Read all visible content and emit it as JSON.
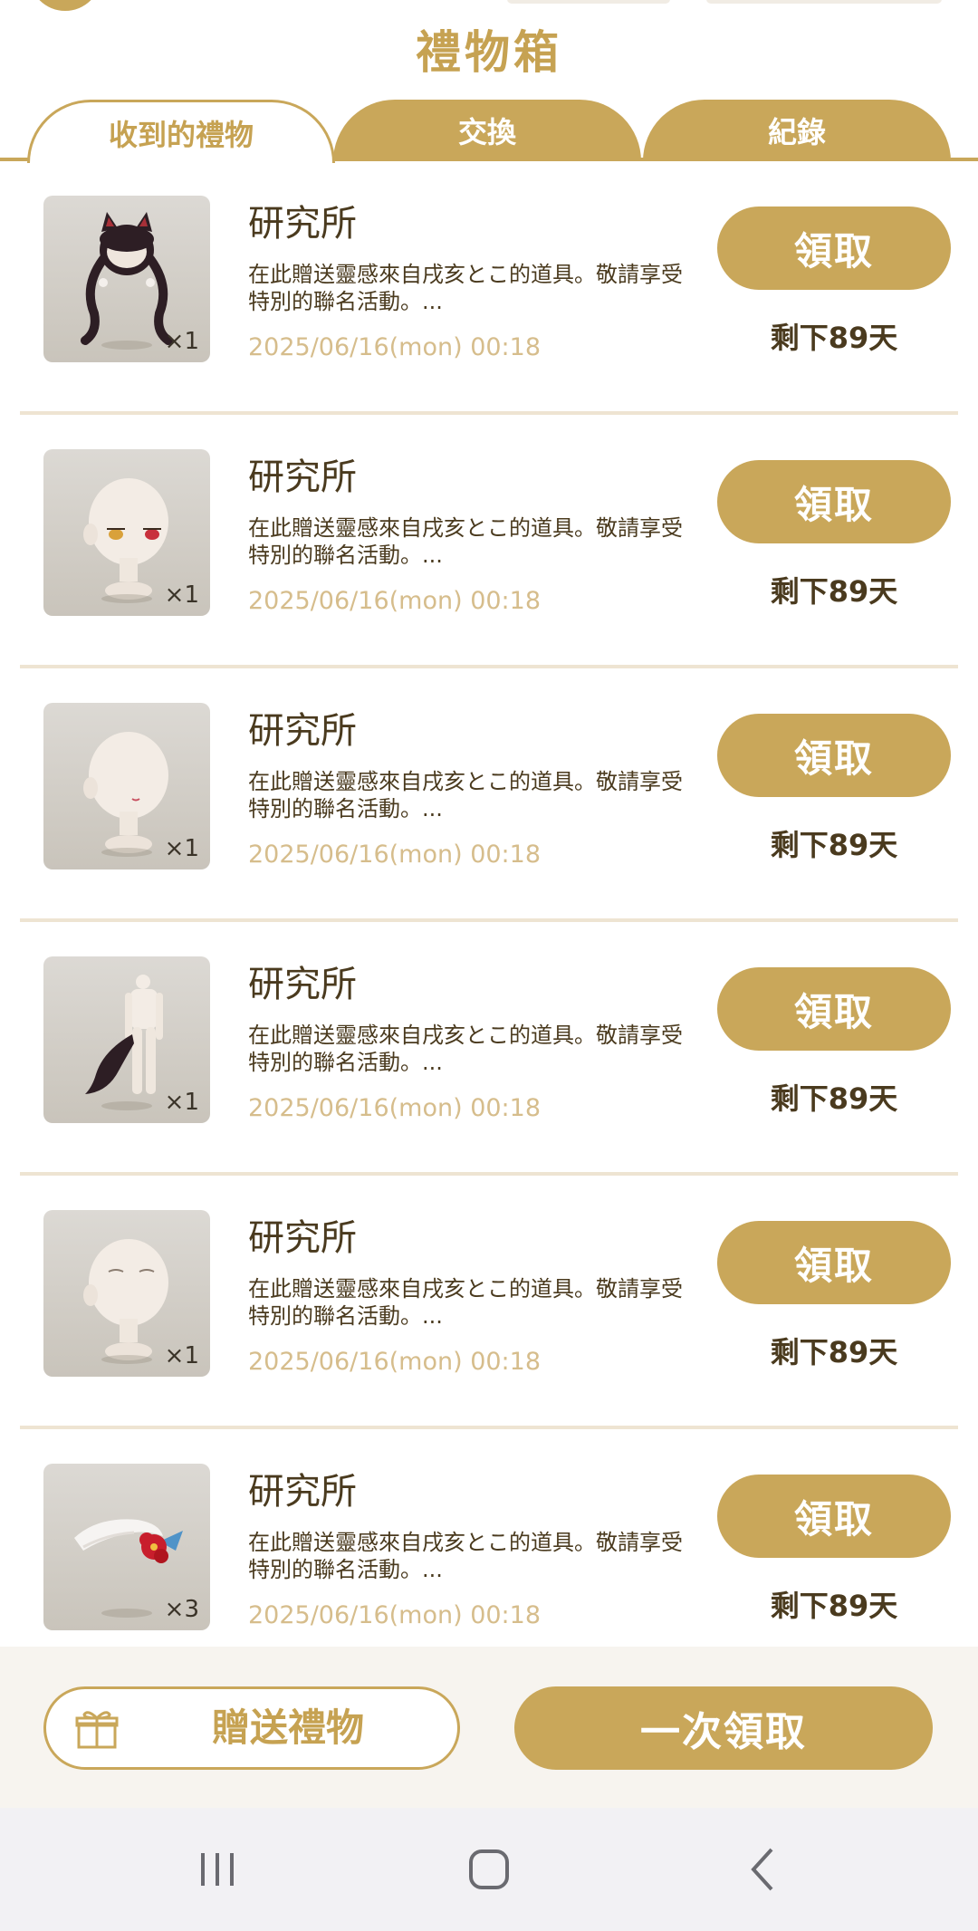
{
  "header": {
    "title": "禮物箱"
  },
  "tabs": [
    {
      "label": "收到的禮物",
      "active": true
    },
    {
      "label": "交換",
      "active": false
    },
    {
      "label": "紀錄",
      "active": false
    }
  ],
  "gifts": [
    {
      "sender": "研究所",
      "description": "在此贈送靈感來自戌亥とこ的道具。敬請享受特別的聯名活動。...",
      "date": "2025/06/16(mon) 00:18",
      "quantity": "×1",
      "item_icon": "twin-tail-hair-icon",
      "claim_label": "領取",
      "remaining": "剩下89天"
    },
    {
      "sender": "研究所",
      "description": "在此贈送靈感來自戌亥とこ的道具。敬請享受特別的聯名活動。...",
      "date": "2025/06/16(mon) 00:18",
      "quantity": "×1",
      "item_icon": "heterochromia-eyes-icon",
      "claim_label": "領取",
      "remaining": "剩下89天"
    },
    {
      "sender": "研究所",
      "description": "在此贈送靈感來自戌亥とこ的道具。敬請享受特別的聯名活動。...",
      "date": "2025/06/16(mon) 00:18",
      "quantity": "×1",
      "item_icon": "mouth-icon",
      "claim_label": "領取",
      "remaining": "剩下89天"
    },
    {
      "sender": "研究所",
      "description": "在此贈送靈感來自戌亥とこ的道具。敬請享受特別的聯名活動。...",
      "date": "2025/06/16(mon) 00:18",
      "quantity": "×1",
      "item_icon": "tail-icon",
      "claim_label": "領取",
      "remaining": "剩下89天"
    },
    {
      "sender": "研究所",
      "description": "在此贈送靈感來自戌亥とこ的道具。敬請享受特別的聯名活動。...",
      "date": "2025/06/16(mon) 00:18",
      "quantity": "×1",
      "item_icon": "closed-eyes-icon",
      "claim_label": "領取",
      "remaining": "剩下89天"
    },
    {
      "sender": "研究所",
      "description": "在此贈送靈感來自戌亥とこ的道具。敬請享受特別的聯名活動。...",
      "date": "2025/06/16(mon) 00:18",
      "quantity": "×3",
      "item_icon": "flower-hairpiece-icon",
      "claim_label": "領取",
      "remaining": "剩下89天"
    }
  ],
  "footer": {
    "send_gift_label": "贈送禮物",
    "claim_all_label": "一次領取"
  },
  "system_nav": {
    "recents_icon": "recents-icon",
    "home_icon": "home-icon",
    "back_icon": "back-icon"
  },
  "colors": {
    "accent": "#c9a75a",
    "title": "#c6a252",
    "date": "#d6bd8c",
    "text": "#4a3a1e",
    "separator": "#eee4d2"
  }
}
